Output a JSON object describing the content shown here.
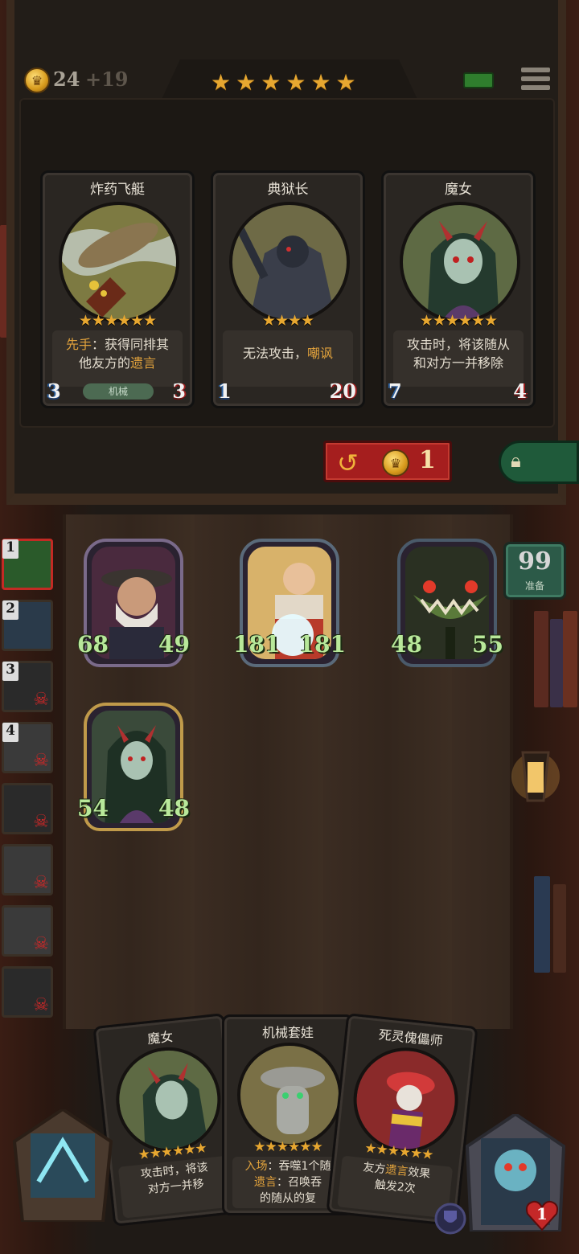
{
  "header": {
    "gold": "24",
    "gold_bonus": "+19",
    "tier_stars": 6
  },
  "shop": {
    "cards": [
      {
        "name": "炸药飞艇",
        "stars": "★★★★★★",
        "desc_parts": [
          {
            "t": "先手",
            "hl": true
          },
          {
            "t": "：获得同排其"
          },
          {
            "t": "他友方的",
            "br": true
          },
          {
            "t": "遗言",
            "hl": true
          }
        ],
        "attack": "3",
        "health": "3",
        "tribe": "机械"
      },
      {
        "name": "典狱长",
        "stars": "★★★★",
        "desc_parts": [
          {
            "t": "无法攻击，"
          },
          {
            "t": "嘲讽",
            "hl": true
          }
        ],
        "attack": "1",
        "health": "20",
        "tribe": ""
      },
      {
        "name": "魔女",
        "stars": "★★★★★★",
        "desc_parts": [
          {
            "t": "攻击时，将该随从"
          },
          {
            "t": "和对方一并移除",
            "br": true
          }
        ],
        "attack": "7",
        "health": "4",
        "tribe": ""
      }
    ],
    "refresh_cost": "1"
  },
  "board": {
    "ready_count": "99",
    "ready_label": "准备",
    "minions": [
      {
        "name": "minion-old-man",
        "attack": "68",
        "health": "49"
      },
      {
        "name": "minion-monk",
        "attack": "181",
        "health": "181"
      },
      {
        "name": "minion-plant",
        "attack": "48",
        "health": "55"
      },
      {
        "name": "minion-witch",
        "attack": "54",
        "health": "48"
      }
    ]
  },
  "opponents": [
    {
      "rank": "1",
      "dead": false
    },
    {
      "rank": "2",
      "dead": false
    },
    {
      "rank": "3",
      "dead": true
    },
    {
      "rank": "4",
      "dead": true
    },
    {
      "rank": "",
      "dead": true
    },
    {
      "rank": "",
      "dead": true
    },
    {
      "rank": "",
      "dead": true
    },
    {
      "rank": "",
      "dead": true
    }
  ],
  "hand": {
    "cards": [
      {
        "name": "魔女",
        "stars": "★★★★★★",
        "desc_line1": "攻击时，将该",
        "desc_line2": "对方一并移"
      },
      {
        "name": "机械套娃",
        "stars": "★★★★★★",
        "desc_line1_hl": "入场",
        "desc_line1": "：吞噬1个随",
        "desc_line2_hl": "遗言",
        "desc_line2": "：召唤吞",
        "desc_line3": "的随从的复"
      },
      {
        "name": "死灵傀儡师",
        "stars": "★★★★★★",
        "desc_line1a": "友方",
        "desc_line1_hl": "遗言",
        "desc_line1b": "效果",
        "desc_line2": "触发2次"
      }
    ]
  },
  "player": {
    "health": "1"
  },
  "colors": {
    "gold_star": "#e7a730",
    "stat_green": "#b8e89a",
    "refresh_red": "#a51e1e"
  }
}
